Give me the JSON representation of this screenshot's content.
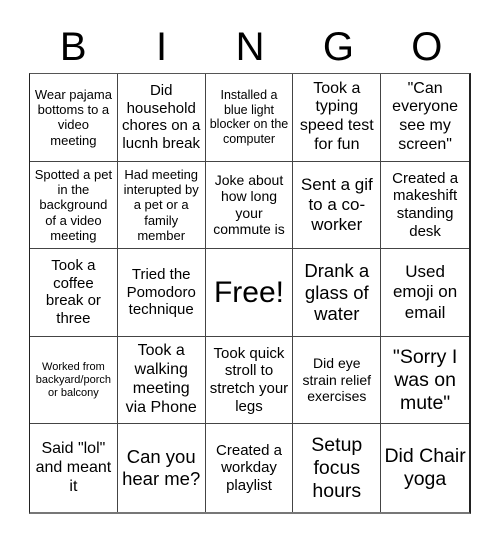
{
  "header": {
    "letters": [
      "B",
      "I",
      "N",
      "G",
      "O"
    ]
  },
  "cells": [
    "Wear pajama bottoms to a video meeting",
    "Did household chores on a lucnh break",
    "Installed a blue light blocker on the computer",
    "Took a typing speed test for fun",
    "\"Can everyone see my screen\"",
    "Spotted a pet in the background of a video meeting",
    "Had meeting interupted by a pet or a family member",
    "Joke about how long your commute is",
    "Sent a gif to a co-worker",
    "Created a makeshift standing desk",
    "Took a coffee break or three",
    "Tried the Pomodoro technique",
    "Free!",
    "Drank a glass of water",
    "Used emoji on email",
    "Worked from backyard/porch or balcony",
    "Took a walking meeting via Phone",
    "Took quick stroll to stretch your legs",
    "Did eye strain relief exercises",
    "\"Sorry I was on mute\"",
    "Said \"lol\" and meant it",
    "Can you hear me?",
    "Created a workday playlist",
    "Setup focus hours",
    "Did Chair yoga"
  ]
}
